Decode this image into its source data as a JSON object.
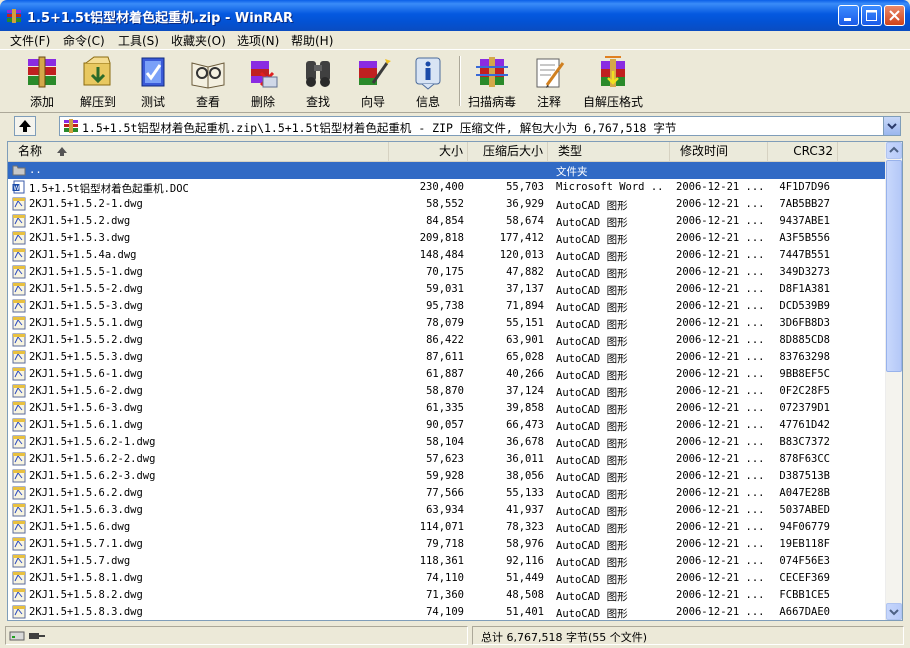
{
  "window": {
    "title": "1.5+1.5t铝型材着色起重机.zip - WinRAR"
  },
  "menu": [
    "文件(F)",
    "命令(C)",
    "工具(S)",
    "收藏夹(O)",
    "选项(N)",
    "帮助(H)"
  ],
  "toolbar": [
    {
      "label": "添加",
      "icon": "add-archive-icon"
    },
    {
      "label": "解压到",
      "icon": "extract-to-icon"
    },
    {
      "label": "测试",
      "icon": "test-icon"
    },
    {
      "label": "查看",
      "icon": "view-icon"
    },
    {
      "label": "删除",
      "icon": "delete-icon"
    },
    {
      "label": "查找",
      "icon": "find-icon"
    },
    {
      "label": "向导",
      "icon": "wizard-icon"
    },
    {
      "label": "信息",
      "icon": "info-icon"
    },
    {
      "label": "扫描病毒",
      "icon": "virus-scan-icon"
    },
    {
      "label": "注释",
      "icon": "comment-icon"
    },
    {
      "label": "自解压格式",
      "icon": "sfx-icon"
    }
  ],
  "address": {
    "path": "1.5+1.5t铝型材着色起重机.zip\\1.5+1.5t铝型材着色起重机 - ZIP 压缩文件, 解包大小为 6,767,518 字节"
  },
  "columns": [
    "名称",
    "大小",
    "压缩后大小",
    "类型",
    "修改时间",
    "CRC32"
  ],
  "rows": [
    {
      "name": "..",
      "size": "",
      "packed": "",
      "type": "文件夹",
      "modified": "",
      "crc": "",
      "icon": "folder",
      "selected": true
    },
    {
      "name": "1.5+1.5t铝型材着色起重机.DOC",
      "size": "230,400",
      "packed": "55,703",
      "type": "Microsoft Word ...",
      "modified": "2006-12-21 ...",
      "crc": "4F1D7D96",
      "icon": "doc"
    },
    {
      "name": "2KJ1.5+1.5.2-1.dwg",
      "size": "58,552",
      "packed": "36,929",
      "type": "AutoCAD 图形",
      "modified": "2006-12-21 ...",
      "crc": "7AB5BB27",
      "icon": "dwg"
    },
    {
      "name": "2KJ1.5+1.5.2.dwg",
      "size": "84,854",
      "packed": "58,674",
      "type": "AutoCAD 图形",
      "modified": "2006-12-21 ...",
      "crc": "9437ABE1",
      "icon": "dwg"
    },
    {
      "name": "2KJ1.5+1.5.3.dwg",
      "size": "209,818",
      "packed": "177,412",
      "type": "AutoCAD 图形",
      "modified": "2006-12-21 ...",
      "crc": "A3F5B556",
      "icon": "dwg"
    },
    {
      "name": "2KJ1.5+1.5.4a.dwg",
      "size": "148,484",
      "packed": "120,013",
      "type": "AutoCAD 图形",
      "modified": "2006-12-21 ...",
      "crc": "7447B551",
      "icon": "dwg"
    },
    {
      "name": "2KJ1.5+1.5.5-1.dwg",
      "size": "70,175",
      "packed": "47,882",
      "type": "AutoCAD 图形",
      "modified": "2006-12-21 ...",
      "crc": "349D3273",
      "icon": "dwg"
    },
    {
      "name": "2KJ1.5+1.5.5-2.dwg",
      "size": "59,031",
      "packed": "37,137",
      "type": "AutoCAD 图形",
      "modified": "2006-12-21 ...",
      "crc": "D8F1A381",
      "icon": "dwg"
    },
    {
      "name": "2KJ1.5+1.5.5-3.dwg",
      "size": "95,738",
      "packed": "71,894",
      "type": "AutoCAD 图形",
      "modified": "2006-12-21 ...",
      "crc": "DCD539B9",
      "icon": "dwg"
    },
    {
      "name": "2KJ1.5+1.5.5.1.dwg",
      "size": "78,079",
      "packed": "55,151",
      "type": "AutoCAD 图形",
      "modified": "2006-12-21 ...",
      "crc": "3D6FB8D3",
      "icon": "dwg"
    },
    {
      "name": "2KJ1.5+1.5.5.2.dwg",
      "size": "86,422",
      "packed": "63,901",
      "type": "AutoCAD 图形",
      "modified": "2006-12-21 ...",
      "crc": "8D885CD8",
      "icon": "dwg"
    },
    {
      "name": "2KJ1.5+1.5.5.3.dwg",
      "size": "87,611",
      "packed": "65,028",
      "type": "AutoCAD 图形",
      "modified": "2006-12-21 ...",
      "crc": "83763298",
      "icon": "dwg"
    },
    {
      "name": "2KJ1.5+1.5.6-1.dwg",
      "size": "61,887",
      "packed": "40,266",
      "type": "AutoCAD 图形",
      "modified": "2006-12-21 ...",
      "crc": "9BB8EF5C",
      "icon": "dwg"
    },
    {
      "name": "2KJ1.5+1.5.6-2.dwg",
      "size": "58,870",
      "packed": "37,124",
      "type": "AutoCAD 图形",
      "modified": "2006-12-21 ...",
      "crc": "0F2C28F5",
      "icon": "dwg"
    },
    {
      "name": "2KJ1.5+1.5.6-3.dwg",
      "size": "61,335",
      "packed": "39,858",
      "type": "AutoCAD 图形",
      "modified": "2006-12-21 ...",
      "crc": "072379D1",
      "icon": "dwg"
    },
    {
      "name": "2KJ1.5+1.5.6.1.dwg",
      "size": "90,057",
      "packed": "66,473",
      "type": "AutoCAD 图形",
      "modified": "2006-12-21 ...",
      "crc": "47761D42",
      "icon": "dwg"
    },
    {
      "name": "2KJ1.5+1.5.6.2-1.dwg",
      "size": "58,104",
      "packed": "36,678",
      "type": "AutoCAD 图形",
      "modified": "2006-12-21 ...",
      "crc": "B83C7372",
      "icon": "dwg"
    },
    {
      "name": "2KJ1.5+1.5.6.2-2.dwg",
      "size": "57,623",
      "packed": "36,011",
      "type": "AutoCAD 图形",
      "modified": "2006-12-21 ...",
      "crc": "878F63CC",
      "icon": "dwg"
    },
    {
      "name": "2KJ1.5+1.5.6.2-3.dwg",
      "size": "59,928",
      "packed": "38,056",
      "type": "AutoCAD 图形",
      "modified": "2006-12-21 ...",
      "crc": "D387513B",
      "icon": "dwg"
    },
    {
      "name": "2KJ1.5+1.5.6.2.dwg",
      "size": "77,566",
      "packed": "55,133",
      "type": "AutoCAD 图形",
      "modified": "2006-12-21 ...",
      "crc": "A047E28B",
      "icon": "dwg"
    },
    {
      "name": "2KJ1.5+1.5.6.3.dwg",
      "size": "63,934",
      "packed": "41,937",
      "type": "AutoCAD 图形",
      "modified": "2006-12-21 ...",
      "crc": "5037ABED",
      "icon": "dwg"
    },
    {
      "name": "2KJ1.5+1.5.6.dwg",
      "size": "114,071",
      "packed": "78,323",
      "type": "AutoCAD 图形",
      "modified": "2006-12-21 ...",
      "crc": "94F06779",
      "icon": "dwg"
    },
    {
      "name": "2KJ1.5+1.5.7.1.dwg",
      "size": "79,718",
      "packed": "58,976",
      "type": "AutoCAD 图形",
      "modified": "2006-12-21 ...",
      "crc": "19EB118F",
      "icon": "dwg"
    },
    {
      "name": "2KJ1.5+1.5.7.dwg",
      "size": "118,361",
      "packed": "92,116",
      "type": "AutoCAD 图形",
      "modified": "2006-12-21 ...",
      "crc": "074F56E3",
      "icon": "dwg"
    },
    {
      "name": "2KJ1.5+1.5.8.1.dwg",
      "size": "74,110",
      "packed": "51,449",
      "type": "AutoCAD 图形",
      "modified": "2006-12-21 ...",
      "crc": "CECEF369",
      "icon": "dwg"
    },
    {
      "name": "2KJ1.5+1.5.8.2.dwg",
      "size": "71,360",
      "packed": "48,508",
      "type": "AutoCAD 图形",
      "modified": "2006-12-21 ...",
      "crc": "FCBB1CE5",
      "icon": "dwg"
    },
    {
      "name": "2KJ1.5+1.5.8.3.dwg",
      "size": "74,109",
      "packed": "51,401",
      "type": "AutoCAD 图形",
      "modified": "2006-12-21 ...",
      "crc": "A667DAE0",
      "icon": "dwg"
    }
  ],
  "status": {
    "left": "",
    "right": "总计 6,767,518 字节(55 个文件)"
  }
}
